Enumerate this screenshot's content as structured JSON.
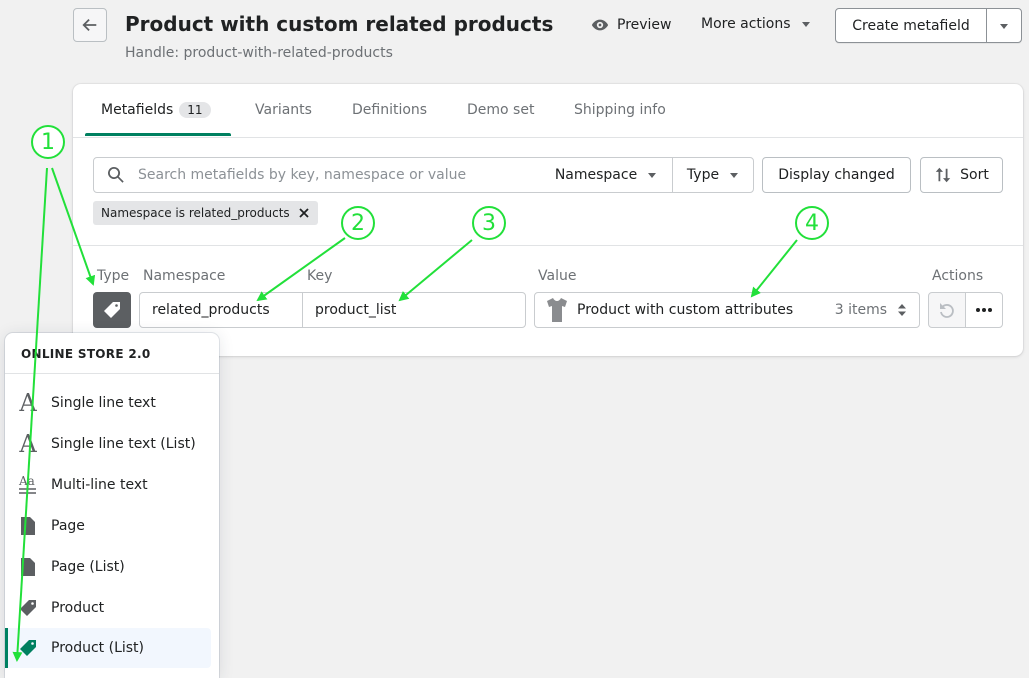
{
  "header": {
    "title": "Product with custom related products",
    "handle": "Handle: product-with-related-products",
    "preview_label": "Preview",
    "more_actions_label": "More actions",
    "create_label": "Create metafield"
  },
  "tabs": [
    {
      "label": "Metafields",
      "badge": "11"
    },
    {
      "label": "Variants"
    },
    {
      "label": "Definitions"
    },
    {
      "label": "Demo set"
    },
    {
      "label": "Shipping info"
    }
  ],
  "filters": {
    "search_placeholder": "Search metafields by key, namespace or value",
    "namespace_label": "Namespace",
    "type_label": "Type",
    "display_changed_label": "Display changed",
    "sort_label": "Sort",
    "applied_filter": "Namespace is related_products"
  },
  "columns": {
    "type": "Type",
    "namespace": "Namespace",
    "key": "Key",
    "value": "Value",
    "actions": "Actions"
  },
  "row": {
    "namespace": "related_products",
    "key": "product_list",
    "value": "Product with custom attributes",
    "value_count": "3 items"
  },
  "popover": {
    "heading": "ONLINE STORE 2.0",
    "items": [
      {
        "label": "Single line text",
        "icon": "text-icon"
      },
      {
        "label": "Single line text (List)",
        "icon": "text-icon"
      },
      {
        "label": "Multi-line text",
        "icon": "multiline-text-icon"
      },
      {
        "label": "Page",
        "icon": "page-icon"
      },
      {
        "label": "Page (List)",
        "icon": "page-icon"
      },
      {
        "label": "Product",
        "icon": "tag-icon"
      },
      {
        "label": "Product (List)",
        "icon": "tag-icon",
        "selected": true
      }
    ]
  },
  "annotations": [
    "1",
    "2",
    "3",
    "4"
  ],
  "colors": {
    "accent": "#008060",
    "annotation": "#22e03a",
    "type_icon_bg": "#5c5f62"
  }
}
